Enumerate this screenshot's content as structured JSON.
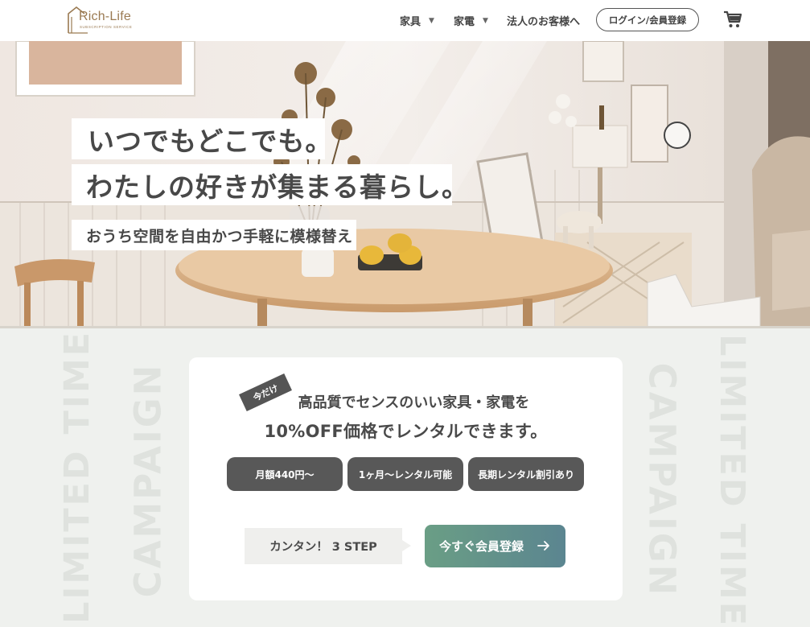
{
  "header": {
    "logo_name": "Rich-Life",
    "logo_sub": "SUBSCRIPTION SERVICE",
    "nav": [
      {
        "label": "家具",
        "has_dropdown": true
      },
      {
        "label": "家電",
        "has_dropdown": true
      },
      {
        "label": "法人のお客様へ",
        "has_dropdown": false
      }
    ],
    "caret": "▼",
    "login_label": "ログイン/会員登録",
    "cart_icon": "cart-icon"
  },
  "hero": {
    "catch_line1": "いつでもどこでも。",
    "catch_line2": "わたしの好きが集まる暮らし。",
    "catch_sub": "おうち空間を自由かつ手軽に模様替え"
  },
  "campaign": {
    "side_text_1": "LIMITED TIME",
    "side_text_2": "CAMPAIGN",
    "tag": "今だけ",
    "line1": "高品質でセンスのいい家具・家電を",
    "line2": "10%OFF価格でレンタルできます。",
    "features": [
      "月額440円〜",
      "1ヶ月〜レンタル可能",
      "長期レンタル割引あり"
    ],
    "step_label": "カンタン！ 3 STEP",
    "register_label": "今すぐ会員登録"
  },
  "colors": {
    "accent_start": "#6a9e85",
    "accent_end": "#5b8590",
    "logo": "#9a7a52",
    "pill": "#585858"
  }
}
